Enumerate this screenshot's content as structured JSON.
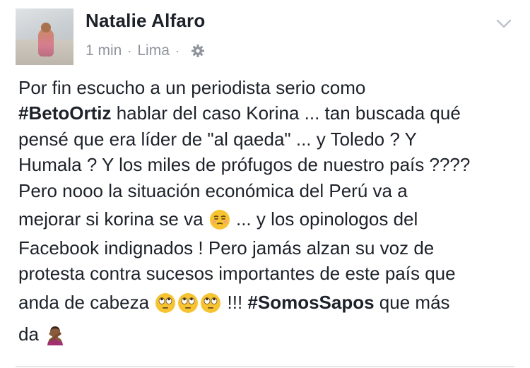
{
  "post": {
    "author": "Natalie Alfaro",
    "time": "1 min",
    "separator": "·",
    "location": "Lima",
    "privacy_icon": "gear-icon",
    "menu_icon": "chevron-down-icon",
    "lines": {
      "l1": "Por fin escucho a un periodista serio como",
      "l2_tag": "#BetoOrtiz",
      "l2_rest": " hablar del caso Korina ... tan buscada qué",
      "l3": "pensé que era líder de \"al qaeda\"  ... y Toledo ? Y",
      "l4": "Humala ? Y los miles de prófugos de nuestro país ????",
      "l5": "Pero nooo la situación económica del Perú va a",
      "l6_a": "mejorar si korina se va ",
      "l6_b": " ... y los opinologos del",
      "l7": "Facebook indignados ! Pero jamás alzan su voz de",
      "l8": "protesta contra sucesos importantes de este país que",
      "l9_a": "anda de cabeza ",
      "l9_b": " !!! ",
      "l9_tag": "#SomosSapos",
      "l9_c": " que más",
      "l10": "da "
    },
    "emojis": [
      "unamused-face-emoji",
      "rolling-eyes-emoji",
      "rolling-eyes-emoji",
      "rolling-eyes-emoji",
      "person-gesturing-no-emoji"
    ]
  }
}
